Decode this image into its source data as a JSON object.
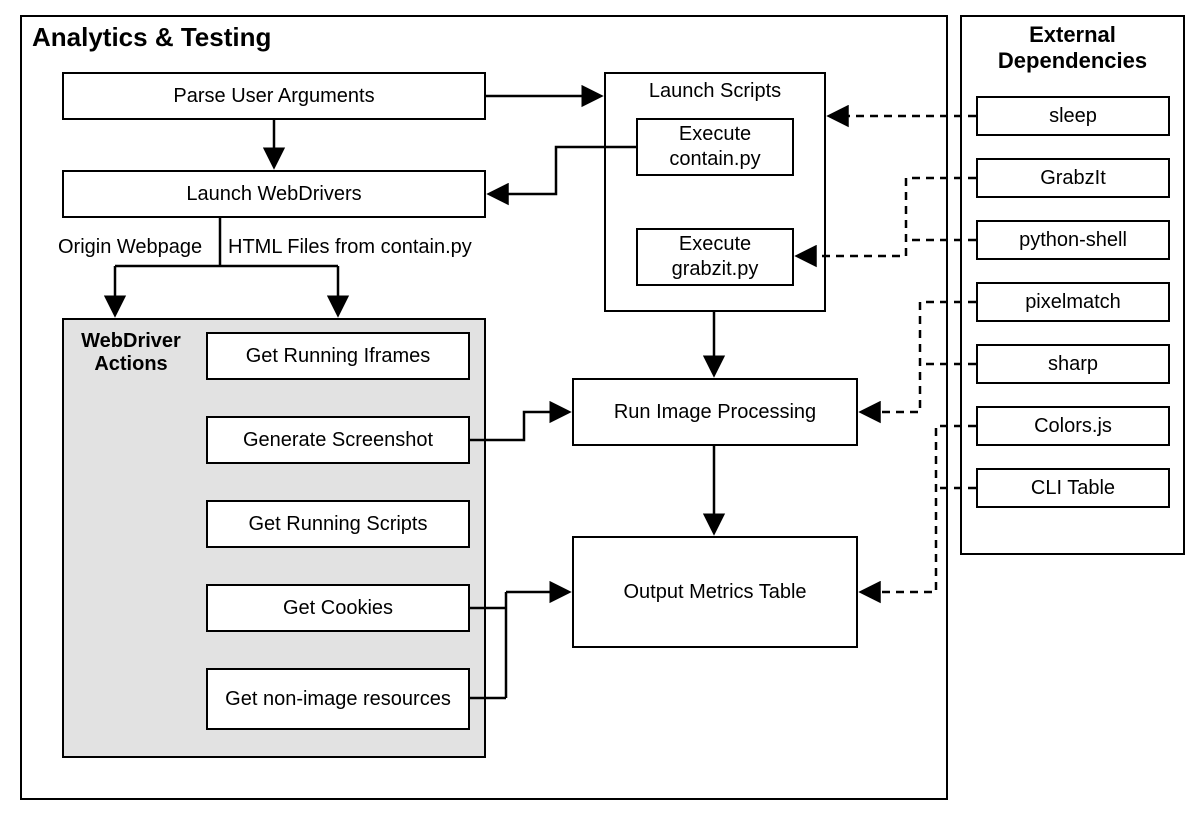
{
  "panels": {
    "analytics": {
      "title": "Analytics & Testing"
    },
    "external": {
      "title": "External Dependencies"
    }
  },
  "nodes": {
    "parse": "Parse User Arguments",
    "launchwd": "Launch WebDrivers",
    "launchscripts_title": "Launch Scripts",
    "exec_contain": "Execute contain.py",
    "exec_grabzit": "Execute grabzit.py",
    "run_image": "Run Image Processing",
    "output_metrics": "Output Metrics Table",
    "wd_actions_title": "WebDriver Actions",
    "wd_iframes": "Get Running Iframes",
    "wd_screenshot": "Generate Screenshot",
    "wd_scripts": "Get Running Scripts",
    "wd_cookies": "Get Cookies",
    "wd_nonimage": "Get non-image resources"
  },
  "edge_labels": {
    "origin": "Origin Webpage",
    "htmlfiles": "HTML Files from contain.py"
  },
  "deps": [
    "sleep",
    "GrabzIt",
    "python-shell",
    "pixelmatch",
    "sharp",
    "Colors.js",
    "CLI Table"
  ]
}
